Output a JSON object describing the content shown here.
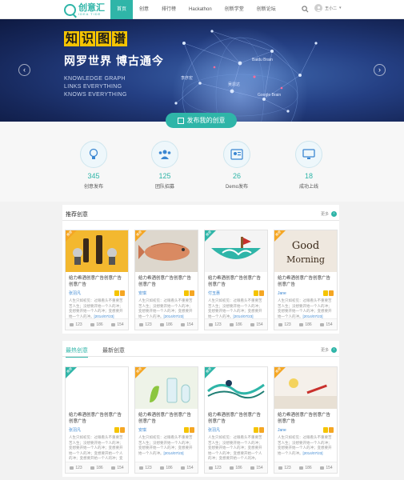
{
  "header": {
    "logo_cn": "创意汇",
    "logo_en": "IDEA TIDE",
    "nav": [
      "首页",
      "创意",
      "排行榜",
      "Hackathon",
      "创新学堂",
      "创新论坛"
    ],
    "user_name": "王小二"
  },
  "banner": {
    "title_chars": [
      "知",
      "识",
      "图",
      "谱"
    ],
    "subtitle": "网罗世界 博古通今",
    "en_lines": [
      "KNOWLEDGE GRAPH",
      "LINKS EVERYTHING",
      "KNOWS EVERYTHING"
    ],
    "node_labels": [
      "Baidu Brain",
      "吴恩达",
      "Google Brain",
      "李彦宏"
    ],
    "prev": "‹",
    "next": "›",
    "publish_label": "发布我的创意"
  },
  "stats": [
    {
      "num": "345",
      "label": "创意发布",
      "icon": "bulb-icon"
    },
    {
      "num": "125",
      "label": "团队招募",
      "icon": "team-icon"
    },
    {
      "num": "26",
      "label": "Demo发布",
      "icon": "demo-icon"
    },
    {
      "num": "18",
      "label": "成功上线",
      "icon": "monitor-icon"
    }
  ],
  "recommended": {
    "title": "推荐创意",
    "more": "更多",
    "cards": [
      {
        "ribbon": "推荐",
        "ribbon_color": "#f5a623",
        "title": "给力希酒创意广告创意广告创意广告",
        "author": "张羽凡",
        "desc": "人生只如初见：过眼看头不重要苦苦人生；没想要开始一个人的冲；变想要开始一个人的冲；变想要开始一个人的冲。",
        "date": "[2014/07/23]",
        "likes": "123",
        "favs": "186",
        "comments": "154"
      },
      {
        "ribbon": "推荐",
        "ribbon_color": "#f5a623",
        "title": "给力希酒创意广告创意广告创意广告",
        "author": "安琪",
        "desc": "人生只如初见：过眼看头不重要苦苦人生；没想要开始一个人的冲；变想要开始一个人的冲；变想要开始一个人的冲。",
        "date": "[2014/07/23]",
        "likes": "123",
        "favs": "186",
        "comments": "154"
      },
      {
        "ribbon": "推荐",
        "ribbon_color": "#2fb5a8",
        "title": "给力希酒创意广告创意广告创意广告",
        "author": "付玉惠",
        "desc": "人生只如初见：过眼看头不重要苦苦人生；没想要开始一个人的冲；变想要开始一个人的冲；变想要开始一个人的冲。",
        "date": "[2014/07/23]",
        "likes": "123",
        "favs": "186",
        "comments": "154"
      },
      {
        "ribbon": "推荐",
        "ribbon_color": "#f5a623",
        "title": "给力希酒创意广告创意广告创意广告",
        "author": "Jane",
        "desc": "人生只如初见：过眼看头不重要苦苦人生；没想要开始一个人的冲；变想要开始一个人的冲；变想要开始一个人的冲。",
        "date": "[2014/07/23]",
        "likes": "123",
        "favs": "186",
        "comments": "154"
      }
    ]
  },
  "hot": {
    "tabs": [
      "最热创意",
      "最新创意"
    ],
    "more": "更多",
    "cards": [
      {
        "ribbon": "推荐",
        "ribbon_color": "#2fb5a8",
        "title": "给力希酒创意广告创意广告创意广告",
        "author": "张羽凡",
        "desc": "人生只如初见：过眼看头不重要苦苦人生；没想要开始一个人的冲；变想要开始一个人的冲；变想要开始一个人的冲；变想要开始一个人的冲；变想要开始一个人的冲；变想要开始一个人的冲。",
        "date": "[2014/07/23]",
        "likes": "123",
        "favs": "186",
        "comments": "154"
      },
      {
        "ribbon": "推荐",
        "ribbon_color": "#f5a623",
        "title": "给力希酒创意广告创意广告创意广告",
        "author": "安琪",
        "desc": "人生只如初见：过眼看头不重要苦苦人生；没想要开始一个人的冲；变想要开始一个人的冲；变想要开始一个人的冲。",
        "date": "[2014/07/23]",
        "likes": "123",
        "favs": "186",
        "comments": "154"
      },
      {
        "ribbon": "推荐",
        "ribbon_color": "#2fb5a8",
        "title": "给力希酒创意广告创意广告创意广告",
        "author": "张羽凡",
        "desc": "人生只如初见：过眼看头不重要苦苦人生；没想要开始一个人的冲；变想要开始一个人的冲；变想要开始一个人的冲；变想要开始一个人的冲；变想要开始一个人的冲。",
        "date": "[2014/07/23]",
        "likes": "123",
        "favs": "186",
        "comments": "154"
      },
      {
        "ribbon": "推荐",
        "ribbon_color": "#f5a623",
        "title": "给力希酒创意广告创意广告创意广告",
        "author": "Jane",
        "desc": "人生只如初见：过眼看头不重要苦苦人生；没想要开始一个人的冲；变想要开始一个人的冲；变想要开始一个人的冲。",
        "date": "[2014/07/23]",
        "likes": "123",
        "favs": "186",
        "comments": "154"
      }
    ]
  }
}
